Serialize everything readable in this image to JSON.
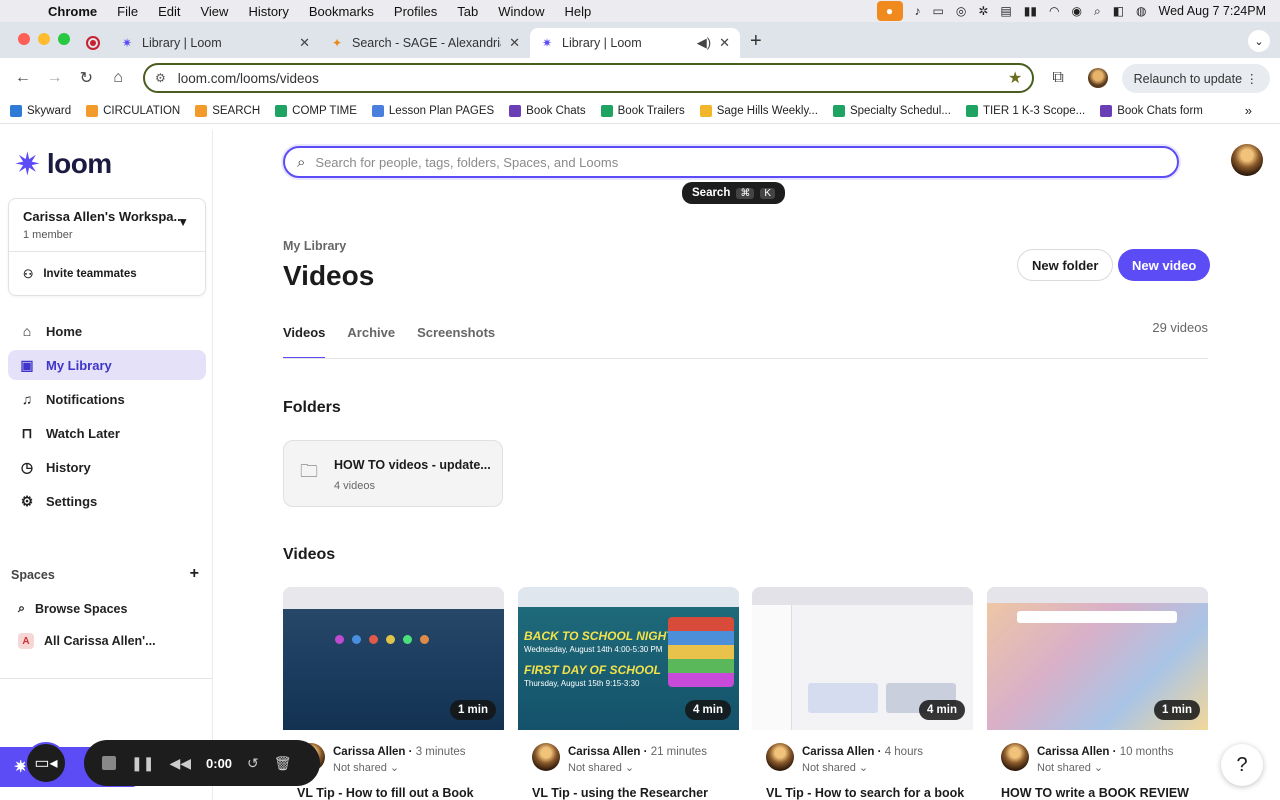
{
  "menubar": {
    "app": "Chrome",
    "items": [
      "File",
      "Edit",
      "View",
      "History",
      "Bookmarks",
      "Profiles",
      "Tab",
      "Window",
      "Help"
    ],
    "clock": "Wed Aug 7  7:24PM"
  },
  "tabs": [
    {
      "title": "Library | Loom"
    },
    {
      "title": "Search - SAGE - Alexandria"
    },
    {
      "title": "Library | Loom"
    }
  ],
  "toolbar": {
    "url": "loom.com/looms/videos",
    "relaunch": "Relaunch to update"
  },
  "bookmarks": [
    {
      "label": "Skyward",
      "color": "#2f7ad6"
    },
    {
      "label": "CIRCULATION",
      "color": "#f29b2b"
    },
    {
      "label": "SEARCH",
      "color": "#f29b2b"
    },
    {
      "label": "COMP TIME",
      "color": "#1ea362"
    },
    {
      "label": "Lesson Plan PAGES",
      "color": "#4a7fdd"
    },
    {
      "label": "Book Chats",
      "color": "#6a3fb5"
    },
    {
      "label": "Book Trailers",
      "color": "#1ea362"
    },
    {
      "label": "Sage Hills Weekly...",
      "color": "#f2b62b"
    },
    {
      "label": "Specialty Schedul...",
      "color": "#1ea362"
    },
    {
      "label": "TIER 1 K-3 Scope...",
      "color": "#1ea362"
    },
    {
      "label": "Book Chats form",
      "color": "#6a3fb5"
    }
  ],
  "sidebar": {
    "logo": "loom",
    "workspace_name": "Carissa Allen's Workspa...",
    "workspace_members": "1 member",
    "invite": "Invite teammates",
    "nav": [
      {
        "label": "Home"
      },
      {
        "label": "My Library"
      },
      {
        "label": "Notifications"
      },
      {
        "label": "Watch Later"
      },
      {
        "label": "History"
      },
      {
        "label": "Settings"
      }
    ],
    "spaces_header": "Spaces",
    "browse_spaces": "Browse Spaces",
    "all_space": "All Carissa Allen'...",
    "all_space_letter": "A"
  },
  "search": {
    "placeholder": "Search for people, tags, folders, Spaces, and Looms",
    "tooltip": "Search",
    "tooltip_key1": "⌘",
    "tooltip_key2": "K"
  },
  "main": {
    "breadcrumb": "My Library",
    "title": "Videos",
    "new_folder": "New folder",
    "new_video": "New video",
    "tabs": [
      "Videos",
      "Archive",
      "Screenshots"
    ],
    "count": "29 videos",
    "folders_heading": "Folders",
    "folder": {
      "name": "HOW TO videos - update...",
      "count": "4 videos"
    },
    "videos_heading": "Videos"
  },
  "videos": [
    {
      "duration": "1 min",
      "author": "Carissa Allen",
      "when": "3 minutes",
      "shared": "Not shared",
      "title": "VL Tip - How to fill out a Book"
    },
    {
      "duration": "4 min",
      "author": "Carissa Allen",
      "when": "21 minutes",
      "shared": "Not shared",
      "title": "VL Tip - using the Researcher",
      "thumb_line1": "BACK TO SCHOOL NIGHT",
      "thumb_line2": "Wednesday, August 14th 4:00-5:30 PM",
      "thumb_line3": "FIRST DAY OF SCHOOL",
      "thumb_line4": "Thursday, August 15th 9:15-3:30"
    },
    {
      "duration": "4 min",
      "author": "Carissa Allen",
      "when": "4 hours",
      "shared": "Not shared",
      "title": "VL Tip - How to search for a book"
    },
    {
      "duration": "1 min",
      "author": "Carissa Allen",
      "when": "10 months",
      "shared": "Not shared",
      "title": "HOW TO write a BOOK REVIEW"
    }
  ],
  "recorder": {
    "label": "Record",
    "time": "0:00"
  },
  "help": "?"
}
